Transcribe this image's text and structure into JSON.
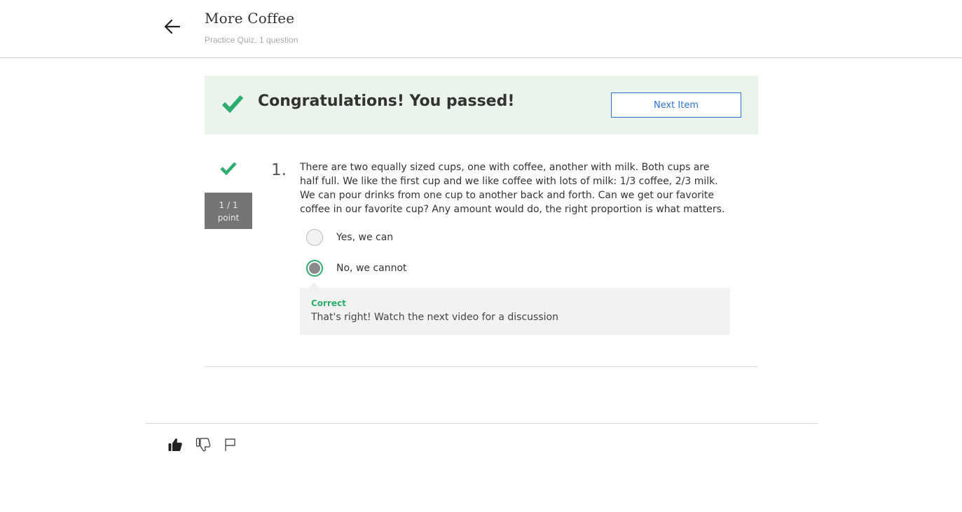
{
  "header": {
    "title": "More Coffee",
    "subtitle": "Practice Quiz, 1 question"
  },
  "banner": {
    "message": "Congratulations! You passed!",
    "next_button_label": "Next Item"
  },
  "question": {
    "number": "1.",
    "points_score": "1 / 1",
    "points_unit": "point",
    "text": "There are two equally sized cups, one with coffee, another with milk. Both cups are half full. We like the first cup and we like coffee with lots of milk: 1/3 coffee, 2/3 milk. We can pour drinks from one cup to another back and forth. Can we get our favorite coffee in our favorite cup? Any amount would do, the right proportion is what matters.",
    "options": [
      {
        "label": "Yes, we can",
        "selected": false
      },
      {
        "label": "No, we cannot",
        "selected": true
      }
    ],
    "feedback": {
      "status": "Correct",
      "message": "That's right! Watch the next video for a discussion"
    }
  },
  "colors": {
    "success_green": "#2cac6f",
    "banner_bg": "#ebf4ea",
    "link_blue": "#2a73cc",
    "points_bg": "#757575"
  },
  "icons": [
    "back-arrow-icon",
    "check-icon",
    "thumbs-up-icon",
    "thumbs-down-icon",
    "flag-icon"
  ]
}
